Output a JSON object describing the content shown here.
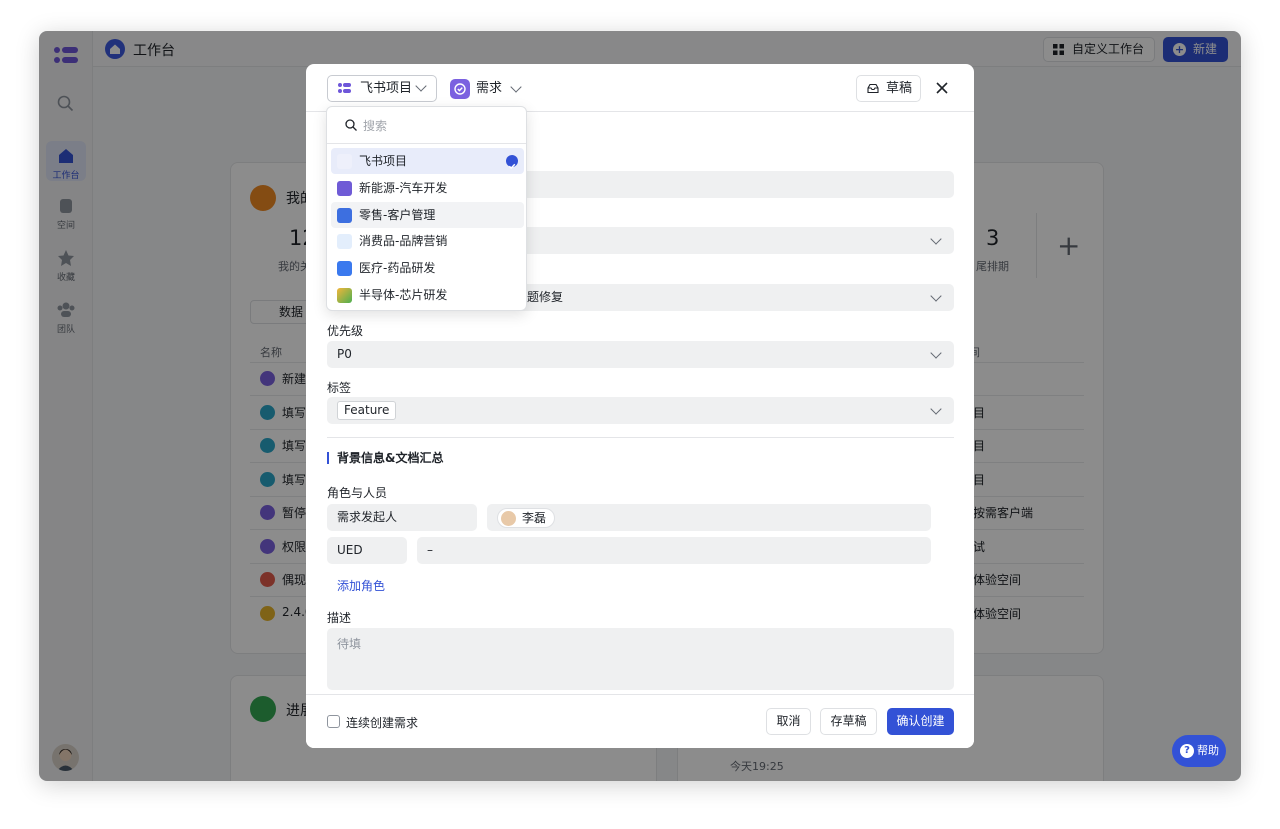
{
  "topbar": {
    "title": "工作台",
    "custom_label": "自定义工作台",
    "new_label": "新建"
  },
  "rail": {
    "items": [
      "工作台",
      "空间",
      "收藏",
      "团队"
    ]
  },
  "background": {
    "card_title_1": "我的",
    "card_title_2": "进展",
    "stat_left_value": "12",
    "stat_left_label": "我的关",
    "stat_right_value": "3",
    "stat_right_label": "尾排期",
    "plus": "+",
    "data_btn": "数据",
    "name_header": "名称",
    "right_header": "间",
    "rows_left": [
      "新建",
      "填写",
      "填写",
      "填写",
      "暂停",
      "权限",
      "偶现",
      "2.4.0"
    ],
    "rows_right": [
      "",
      "目",
      "目",
      "目",
      "按需客户端",
      "试",
      "体验空间",
      "体验空间"
    ],
    "today": "今天19:25",
    "help": "帮助"
  },
  "modal": {
    "project": "飞书项目",
    "type": "需求",
    "draft_btn": "草稿",
    "fields": {
      "partial_value": "题修复",
      "priority_label": "优先级",
      "priority_value": "P0",
      "tags_label": "标签",
      "tag": "Feature"
    },
    "section_title": "背景信息&文档汇总",
    "roles_label": "角色与人员",
    "roles": [
      {
        "role": "需求发起人",
        "person": "李磊"
      },
      {
        "role": "UED",
        "person": "–"
      }
    ],
    "add_role": "添加角色",
    "desc_label": "描述",
    "desc_placeholder": "待填",
    "footer": {
      "continuous": "连续创建需求",
      "cancel": "取消",
      "save_draft": "存草稿",
      "confirm": "确认创建"
    }
  },
  "dropdown": {
    "search_placeholder": "搜索",
    "items": [
      {
        "label": "飞书项目",
        "color": "#eef0fb"
      },
      {
        "label": "新能源-汽车开发",
        "color": "#6f5bd6"
      },
      {
        "label": "零售-客户管理",
        "color": "#3d6fe0"
      },
      {
        "label": "消费品-品牌营销",
        "color": "#e3eefc"
      },
      {
        "label": "医疗-药品研发",
        "color": "#3a79ee"
      },
      {
        "label": "半导体-芯片研发",
        "color": "#ffffff"
      }
    ]
  },
  "colors": {
    "accent": "#3352d6"
  }
}
